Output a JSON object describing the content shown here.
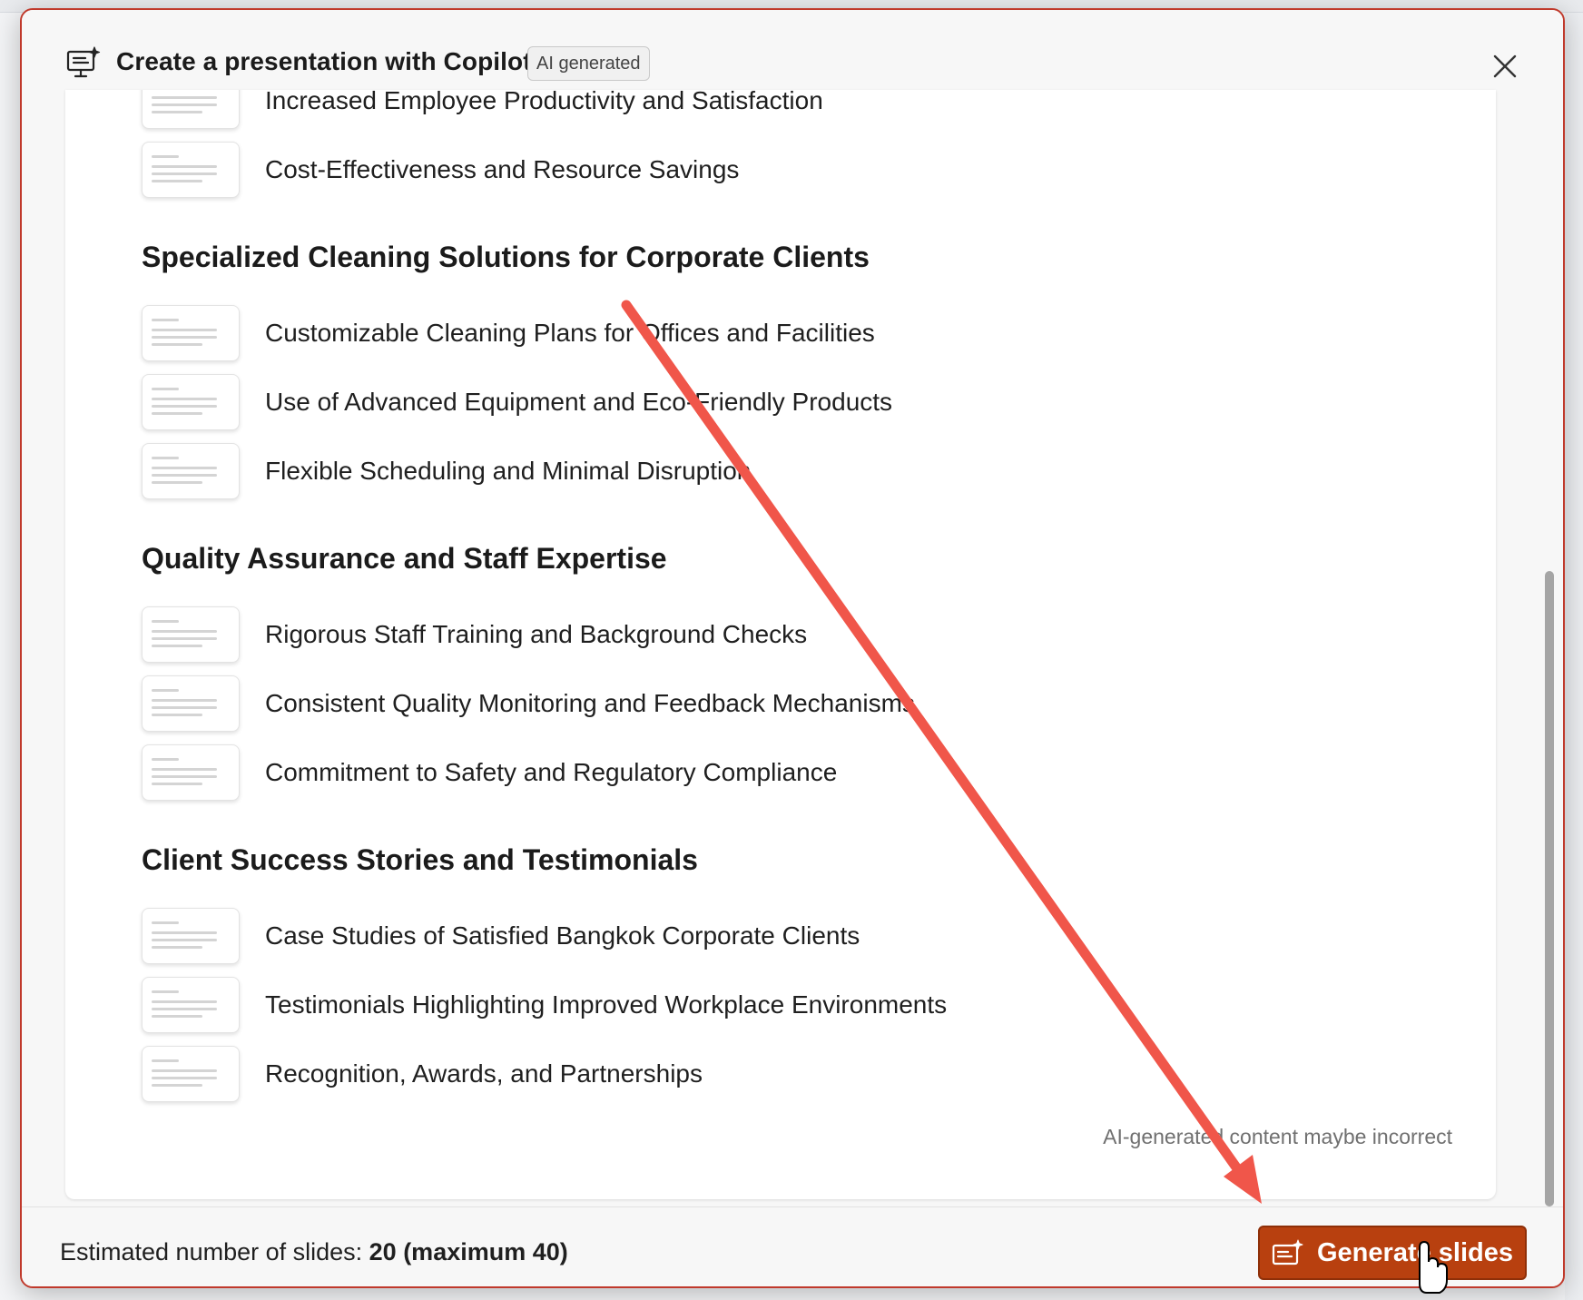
{
  "dialog": {
    "title": "Create a presentation with Copilot",
    "badge": "AI generated",
    "close_icon": "close-icon",
    "header_icon": "presentation-sparkle-icon"
  },
  "outline": {
    "partial_item": "Increased Employee Productivity and Satisfaction",
    "top_items": [
      "Cost-Effectiveness and Resource Savings"
    ],
    "sections": [
      {
        "title": "Specialized Cleaning Solutions for Corporate Clients",
        "items": [
          "Customizable Cleaning Plans for Offices and Facilities",
          "Use of Advanced Equipment and Eco-Friendly Products",
          "Flexible Scheduling and Minimal Disruption"
        ]
      },
      {
        "title": "Quality Assurance and Staff Expertise",
        "items": [
          "Rigorous Staff Training and Background Checks",
          "Consistent Quality Monitoring and Feedback Mechanisms",
          "Commitment to Safety and Regulatory Compliance"
        ]
      },
      {
        "title": "Client Success Stories and Testimonials",
        "items": [
          "Case Studies of Satisfied Bangkok Corporate Clients",
          "Testimonials Highlighting Improved Workplace Environments",
          "Recognition, Awards, and Partnerships"
        ]
      }
    ],
    "disclaimer": "AI-generated content maybe incorrect"
  },
  "footer": {
    "estimate_label": "Estimated number of slides: ",
    "estimate_value": "20 (maximum 40)",
    "generate_label": "Generate slides",
    "generate_icon": "slides-sparkle-icon"
  },
  "colors": {
    "accent": "#b8400f",
    "annotation_arrow": "#f0564a",
    "dialog_border": "#c0392b"
  }
}
